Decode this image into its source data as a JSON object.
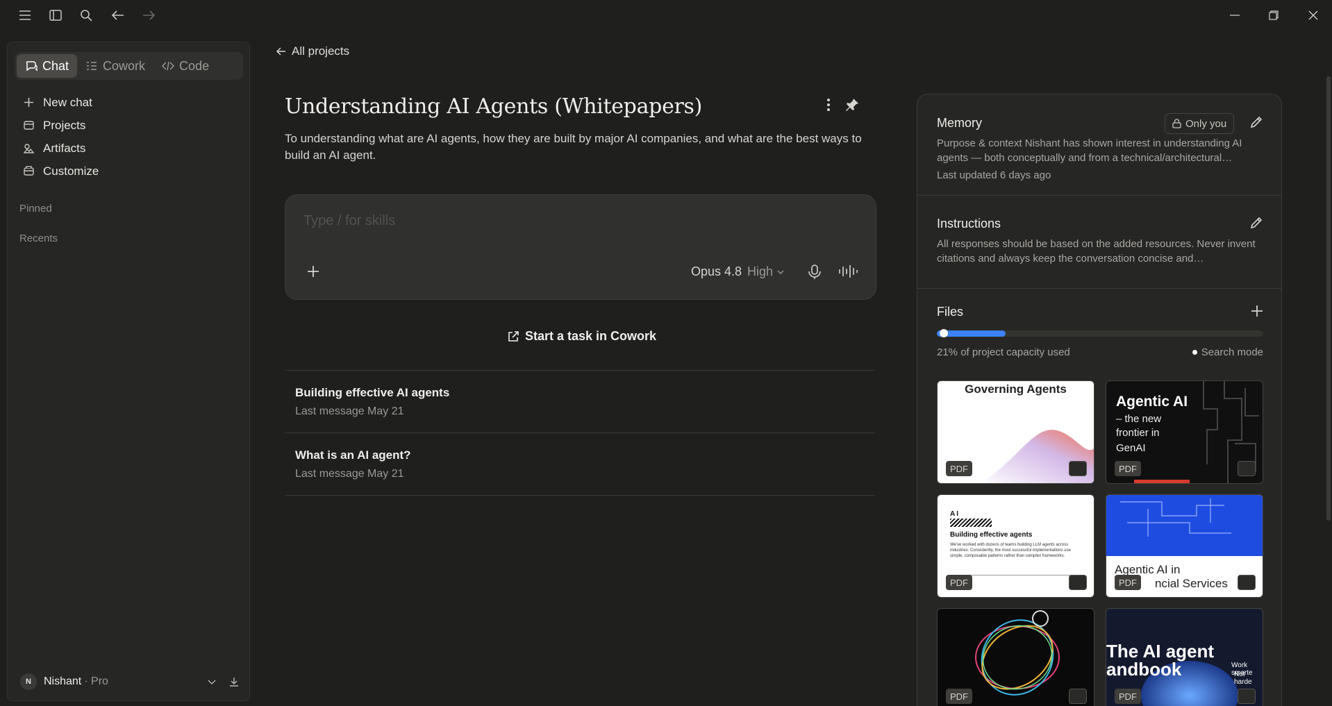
{
  "sidebar": {
    "modes": [
      {
        "label": "Chat",
        "icon": "chat-icon",
        "active": true
      },
      {
        "label": "Cowork",
        "icon": "cowork-icon",
        "active": false
      },
      {
        "label": "Code",
        "icon": "code-icon",
        "active": false
      }
    ],
    "nav": [
      {
        "label": "New chat",
        "icon": "plus-icon"
      },
      {
        "label": "Projects",
        "icon": "projects-icon"
      },
      {
        "label": "Artifacts",
        "icon": "artifacts-icon"
      },
      {
        "label": "Customize",
        "icon": "customize-icon"
      }
    ],
    "pinned_label": "Pinned",
    "recents_label": "Recents",
    "user": {
      "initial": "N",
      "name": "Nishant",
      "plan": "· Pro"
    }
  },
  "main": {
    "back_label": "All projects",
    "title": "Understanding AI Agents (Whitepapers)",
    "description": "To understanding what are AI agents, how they are built by major AI companies, and what are the best ways to build an AI agent.",
    "composer": {
      "placeholder": "Type / for skills",
      "model": "Opus 4.8",
      "effort": "High"
    },
    "cowork_label": "Start a task in Cowork",
    "chats": [
      {
        "title": "Building effective AI agents",
        "meta": "Last message May 21"
      },
      {
        "title": "What is an AI agent?",
        "meta": "Last message May 21"
      }
    ]
  },
  "panel": {
    "memory": {
      "title": "Memory",
      "badge": "Only you",
      "text": "Purpose & context Nishant has shown interest in understanding AI agents — both conceptually and from a technical/architectural…",
      "updated": "Last updated 6 days ago"
    },
    "instructions": {
      "title": "Instructions",
      "text": "All responses should be based on the added resources. Never invent citations and always keep the conversation concise and…"
    },
    "files": {
      "title": "Files",
      "capacity_fraction": 0.21,
      "capacity_text": "21% of project capacity used",
      "search_mode": "Search mode",
      "tag": "PDF",
      "thumb_text": {
        "governing": "Governing Agents",
        "agentic_1": "Agentic AI",
        "agentic_2": "– the new",
        "agentic_3": "frontier in",
        "agentic_4": "GenAI",
        "bea_title": "Building effective agents",
        "bea_body": "We've worked with dozens of teams building LLM agents across industries. Consistently, the most successful implementations use simple, composable patterns rather than complex frameworks.",
        "fin_1": "Agentic AI in",
        "fin_2": "ncial Services",
        "handbook_1": "The AI agent",
        "handbook_2": "andbook",
        "handbook_side_1": "Work smarte",
        "handbook_side_2": "Not harde"
      }
    }
  },
  "colors": {
    "accent_blue": "#3b82f6",
    "background": "#1f1f1e",
    "sidebar": "#262624"
  }
}
